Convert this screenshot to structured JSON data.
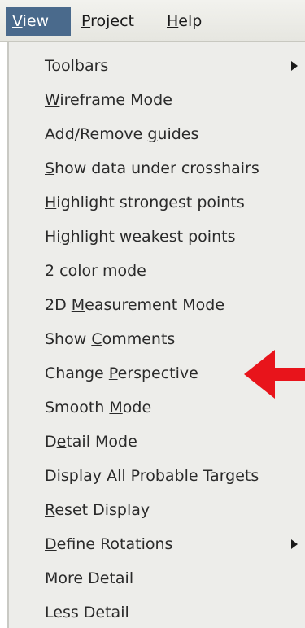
{
  "menubar": {
    "items": [
      {
        "pre": "",
        "mn": "V",
        "post": "iew"
      },
      {
        "pre": "",
        "mn": "P",
        "post": "roject"
      },
      {
        "pre": "",
        "mn": "H",
        "post": "elp"
      }
    ]
  },
  "view_menu": {
    "items": [
      {
        "pre": "",
        "mn": "T",
        "post": "oolbars"
      },
      {
        "pre": "",
        "mn": "W",
        "post": "ireframe Mode"
      },
      {
        "pre": "Add/Remove ",
        "mn": "g",
        "post": "uides"
      },
      {
        "pre": "",
        "mn": "S",
        "post": "how data under crosshairs"
      },
      {
        "pre": "",
        "mn": "H",
        "post": "ighlight strongest points"
      },
      {
        "pre": "Hi",
        "mn": "g",
        "post": "hlight weakest points"
      },
      {
        "pre": "",
        "mn": "2",
        "post": " color mode"
      },
      {
        "pre": "2D ",
        "mn": "M",
        "post": "easurement Mode"
      },
      {
        "pre": "Show ",
        "mn": "C",
        "post": "omments"
      },
      {
        "pre": "Change ",
        "mn": "P",
        "post": "erspective"
      },
      {
        "pre": "Smooth ",
        "mn": "M",
        "post": "ode"
      },
      {
        "pre": "D",
        "mn": "e",
        "post": "tail Mode"
      },
      {
        "pre": "Display ",
        "mn": "A",
        "post": "ll Probable Targets"
      },
      {
        "pre": "",
        "mn": "R",
        "post": "eset Display"
      },
      {
        "pre": "",
        "mn": "D",
        "post": "efine Rotations"
      },
      {
        "pre": "More Detail",
        "mn": "",
        "post": ""
      },
      {
        "pre": "Less Detail",
        "mn": "",
        "post": ""
      }
    ]
  },
  "colors": {
    "menubar_active_bg": "#4a6a8c",
    "menu_bg": "#ededea",
    "annotation_arrow": "#e8141b"
  }
}
